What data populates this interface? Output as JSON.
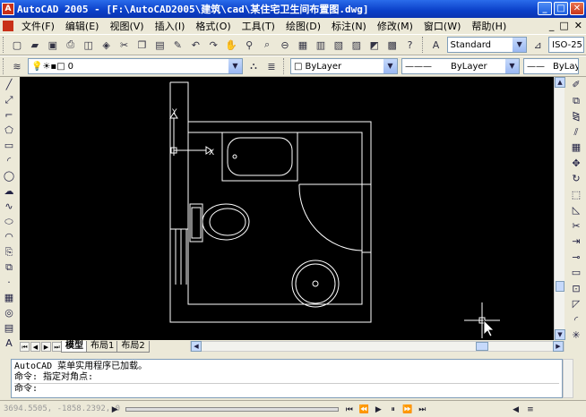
{
  "window": {
    "title": "AutoCAD 2005 - [F:\\AutoCAD2005\\建筑\\cad\\某住宅卫生间布置图.dwg]",
    "minimize": "_",
    "restore": "□",
    "close": "✕"
  },
  "menu": [
    "文件(F)",
    "编辑(E)",
    "视图(V)",
    "插入(I)",
    "格式(O)",
    "工具(T)",
    "绘图(D)",
    "标注(N)",
    "修改(M)",
    "窗口(W)",
    "帮助(H)"
  ],
  "doc_controls": [
    "_",
    "□",
    "✕"
  ],
  "standard_toolbar": {
    "text_style": "Standard",
    "dim_style": "ISO-25"
  },
  "layers_toolbar": {
    "layer": "0",
    "color": "ByLayer",
    "linetype": "ByLayer",
    "lineweight": "ByLay"
  },
  "ucs": {
    "y_label": "Y",
    "x_label": "X"
  },
  "layout_tabs": [
    "模型",
    "布局1",
    "布局2"
  ],
  "command": {
    "lines": [
      "AutoCAD 菜单实用程序已加载。",
      "命令: 指定对角点:"
    ],
    "prompt": "命令:"
  },
  "status": {
    "coords": "3694.5505, -1858.2392, 0"
  },
  "colors": {
    "canvas": "#000000",
    "drawing": "#ffffff",
    "titlebar": "#0a3fc8"
  }
}
